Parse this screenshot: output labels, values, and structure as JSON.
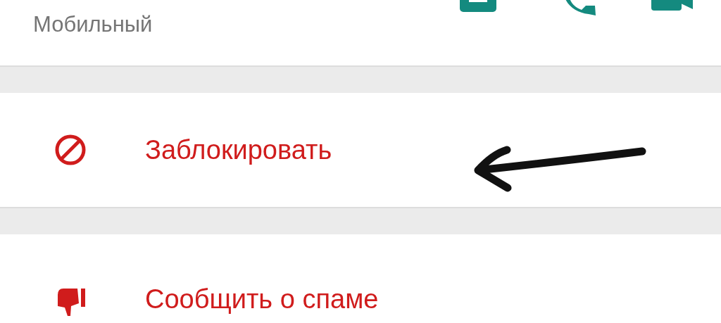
{
  "phone": {
    "type_label": "Мобильный"
  },
  "actions": [
    {
      "kind": "block",
      "label": "Заблокировать"
    },
    {
      "kind": "spam",
      "label": "Сообщить о спаме"
    }
  ]
}
